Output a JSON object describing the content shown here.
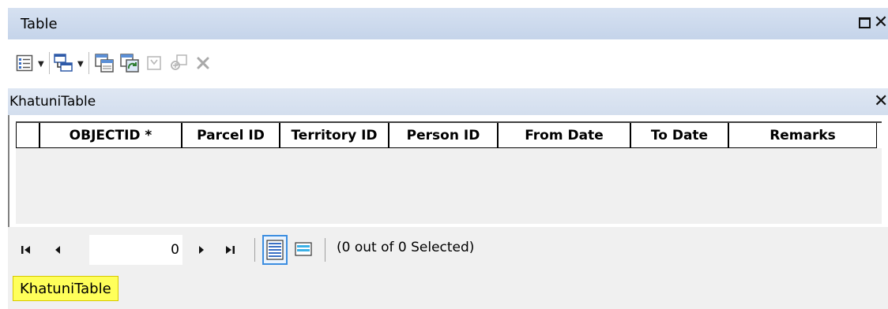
{
  "window": {
    "title": "Table",
    "maximize_icon": "maximize-icon",
    "close_icon": "close-icon"
  },
  "toolbar": {
    "icons": [
      "table-options-icon",
      "related-tables-icon",
      "select-by-attributes-icon",
      "switch-selection-icon",
      "clear-selection-icon",
      "zoom-to-selected-icon",
      "delete-selected-icon"
    ]
  },
  "table_tab": {
    "label": "KhatuniTable",
    "close_glyph": "✕"
  },
  "grid": {
    "columns": [
      "OBJECTID *",
      "Parcel ID",
      "Territory ID",
      "Person ID",
      "From Date",
      "To Date",
      "Remarks"
    ],
    "rows": []
  },
  "navigation": {
    "record_value": "0",
    "selected_text": "(0 out of 0 Selected)",
    "show_all_icon": "show-all-records-icon",
    "show_selected_icon": "show-selected-records-icon"
  },
  "bottom_tabs": [
    {
      "label": "KhatuniTable",
      "highlight": "#ffff5a"
    }
  ],
  "colors": {
    "titlebar": "#c9d7ec",
    "tab_header": "#d9e2f0",
    "highlight": "#ffff5a",
    "active_view_border": "#3c8de0"
  }
}
